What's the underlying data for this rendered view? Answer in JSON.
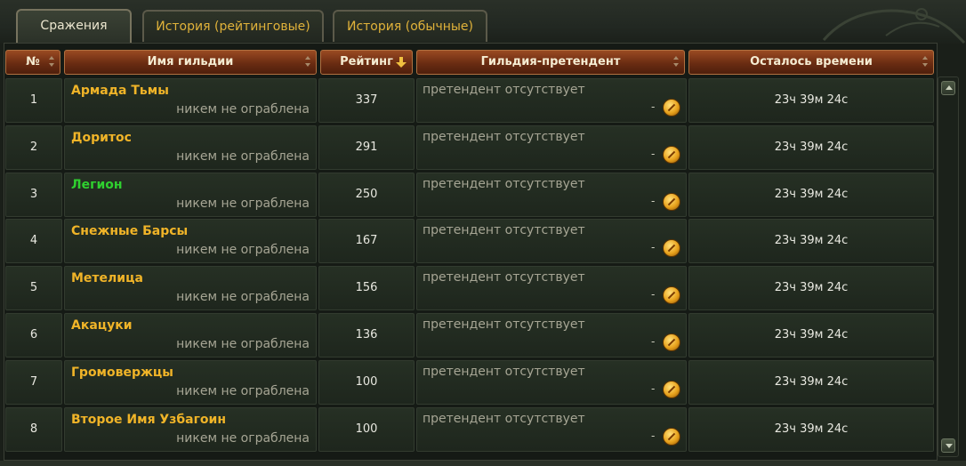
{
  "tabs": [
    {
      "label": "Сражения",
      "active": true
    },
    {
      "label": "История (рейтинговые)",
      "active": false
    },
    {
      "label": "История (обычные)",
      "active": false
    }
  ],
  "columns": {
    "num": "№",
    "guild_name": "Имя гильдии",
    "rating": "Рейтинг",
    "rival": "Гильдия-претендент",
    "time_left": "Осталось времени"
  },
  "sort": {
    "column": "rating",
    "direction": "desc"
  },
  "rows": [
    {
      "num": "1",
      "name": "Армада Тьмы",
      "name_color": "gold",
      "status": "никем не ограблена",
      "rating": "337",
      "rival": "претендент отсутствует",
      "rival_value": "-",
      "time": "23ч 39м 24с"
    },
    {
      "num": "2",
      "name": "Доритос",
      "name_color": "gold",
      "status": "никем не ограблена",
      "rating": "291",
      "rival": "претендент отсутствует",
      "rival_value": "-",
      "time": "23ч 39м 24с"
    },
    {
      "num": "3",
      "name": "Легион",
      "name_color": "green",
      "status": "никем не ограблена",
      "rating": "250",
      "rival": "претендент отсутствует",
      "rival_value": "-",
      "time": "23ч 39м 24с"
    },
    {
      "num": "4",
      "name": "Снежные Барсы",
      "name_color": "gold",
      "status": "никем не ограблена",
      "rating": "167",
      "rival": "претендент отсутствует",
      "rival_value": "-",
      "time": "23ч 39м 24с"
    },
    {
      "num": "5",
      "name": "Метелица",
      "name_color": "gold",
      "status": "никем не ограблена",
      "rating": "156",
      "rival": "претендент отсутствует",
      "rival_value": "-",
      "time": "23ч 39м 24с"
    },
    {
      "num": "6",
      "name": "Акацуки",
      "name_color": "gold",
      "status": "никем не ограблена",
      "rating": "136",
      "rival": "претендент отсутствует",
      "rival_value": "-",
      "time": "23ч 39м 24с"
    },
    {
      "num": "7",
      "name": "Громовержцы",
      "name_color": "gold",
      "status": "никем не ограблена",
      "rating": "100",
      "rival": "претендент отсутствует",
      "rival_value": "-",
      "time": "23ч 39м 24с"
    },
    {
      "num": "8",
      "name": "Второе Имя Узбагоин",
      "name_color": "gold",
      "status": "никем не ограблена",
      "rating": "100",
      "rival": "претендент отсутствует",
      "rival_value": "-",
      "time": "23ч 39м 24с"
    }
  ],
  "colors": {
    "gold": "#f0b428",
    "green": "#2fd02f",
    "header": "#7a3416"
  },
  "icons": {
    "attack": "gold-coin-icon"
  }
}
